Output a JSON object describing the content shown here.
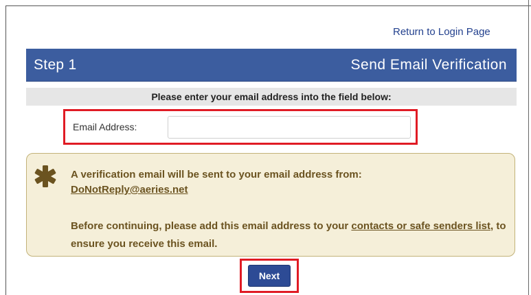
{
  "header": {
    "return_link": "Return to Login Page"
  },
  "step": {
    "number_label": "Step 1",
    "title": "Send Email Verification"
  },
  "instruction": "Please enter your email address into the field below:",
  "form": {
    "email_label": "Email Address:",
    "email_value": "",
    "email_placeholder": ""
  },
  "notice": {
    "icon": "asterisk-icon",
    "line1": "A verification email will be sent to your email address from:",
    "address": "DoNotReply@aeries.net",
    "para_before": "Before continuing, please add this email address to your ",
    "para_link": "contacts or safe senders list",
    "para_after": ", to ensure you receive this email."
  },
  "actions": {
    "next_label": "Next"
  },
  "colors": {
    "header_blue": "#3c5d9f",
    "button_blue": "#2d4b95",
    "highlight_red": "#e01b24",
    "notice_bg": "#f5efd9",
    "notice_text": "#6b5320"
  }
}
